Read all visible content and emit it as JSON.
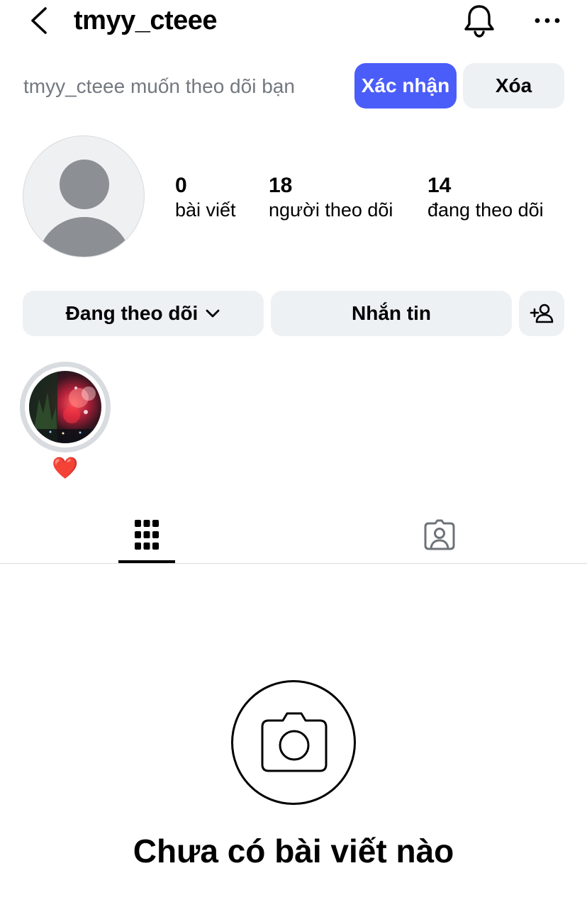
{
  "header": {
    "username": "tmyy_cteee",
    "icons": {
      "back": "chevron-left-icon",
      "notifications": "bell-icon",
      "more": "more-horizontal-icon"
    }
  },
  "follow_request": {
    "text": "tmyy_cteee muốn theo dõi bạn",
    "confirm_label": "Xác nhận",
    "delete_label": "Xóa"
  },
  "profile": {
    "stats": [
      {
        "count": "0",
        "label": "bài viết"
      },
      {
        "count": "18",
        "label": "người theo dõi"
      },
      {
        "count": "14",
        "label": "đang theo dõi"
      }
    ]
  },
  "actions": {
    "following_label": "Đang theo dõi",
    "message_label": "Nhắn tin",
    "add_person_icon": "person-add-icon"
  },
  "highlights": [
    {
      "label": "❤️"
    }
  ],
  "tabs": [
    {
      "icon": "grid-icon",
      "active": true
    },
    {
      "icon": "tagged-person-icon",
      "active": false
    }
  ],
  "empty_state": {
    "icon": "camera-icon",
    "text": "Chưa có bài viết nào"
  },
  "colors": {
    "accent": "#4a5df9",
    "button_bg": "#eef1f4",
    "muted_text": "#73787f"
  }
}
